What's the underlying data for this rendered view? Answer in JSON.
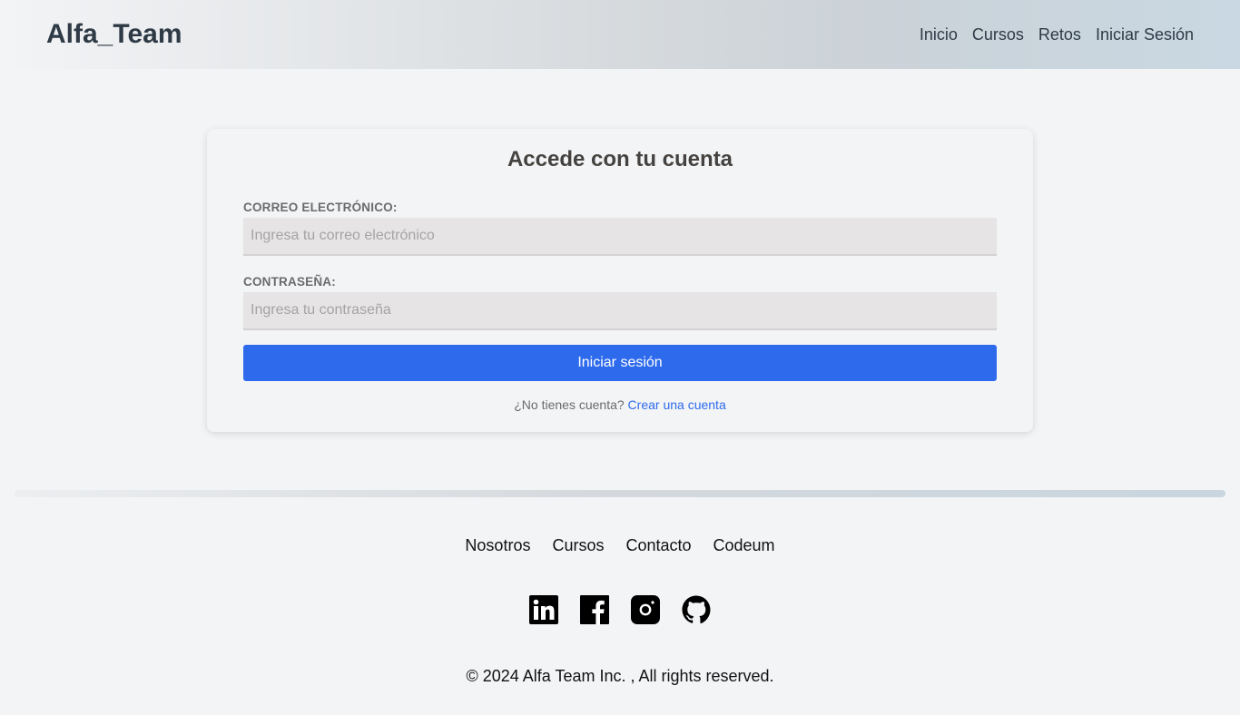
{
  "header": {
    "brand": "Alfa_Team",
    "nav": [
      "Inicio",
      "Cursos",
      "Retos",
      "Iniciar Sesión"
    ]
  },
  "login": {
    "title": "Accede con tu cuenta",
    "email_label": "CORREO ELECTRÓNICO:",
    "email_placeholder": "Ingresa tu correo electrónico",
    "email_value": "",
    "password_label": "CONTRASEÑA:",
    "password_placeholder": "Ingresa tu contraseña",
    "password_value": "",
    "submit_label": "Iniciar sesión",
    "no_account_text": "¿No tienes cuenta?",
    "create_account_link": "Crear una cuenta"
  },
  "footer": {
    "links": [
      "Nosotros",
      "Cursos",
      "Contacto",
      "Codeum"
    ],
    "social": [
      "linkedin-icon",
      "facebook-icon",
      "instagram-icon",
      "github-icon"
    ],
    "copyright": "© 2024 Alfa Team Inc. , All rights reserved."
  },
  "colors": {
    "accent": "#2e6bec",
    "background": "#f2f4f6",
    "brand_text": "#2e3a46"
  }
}
